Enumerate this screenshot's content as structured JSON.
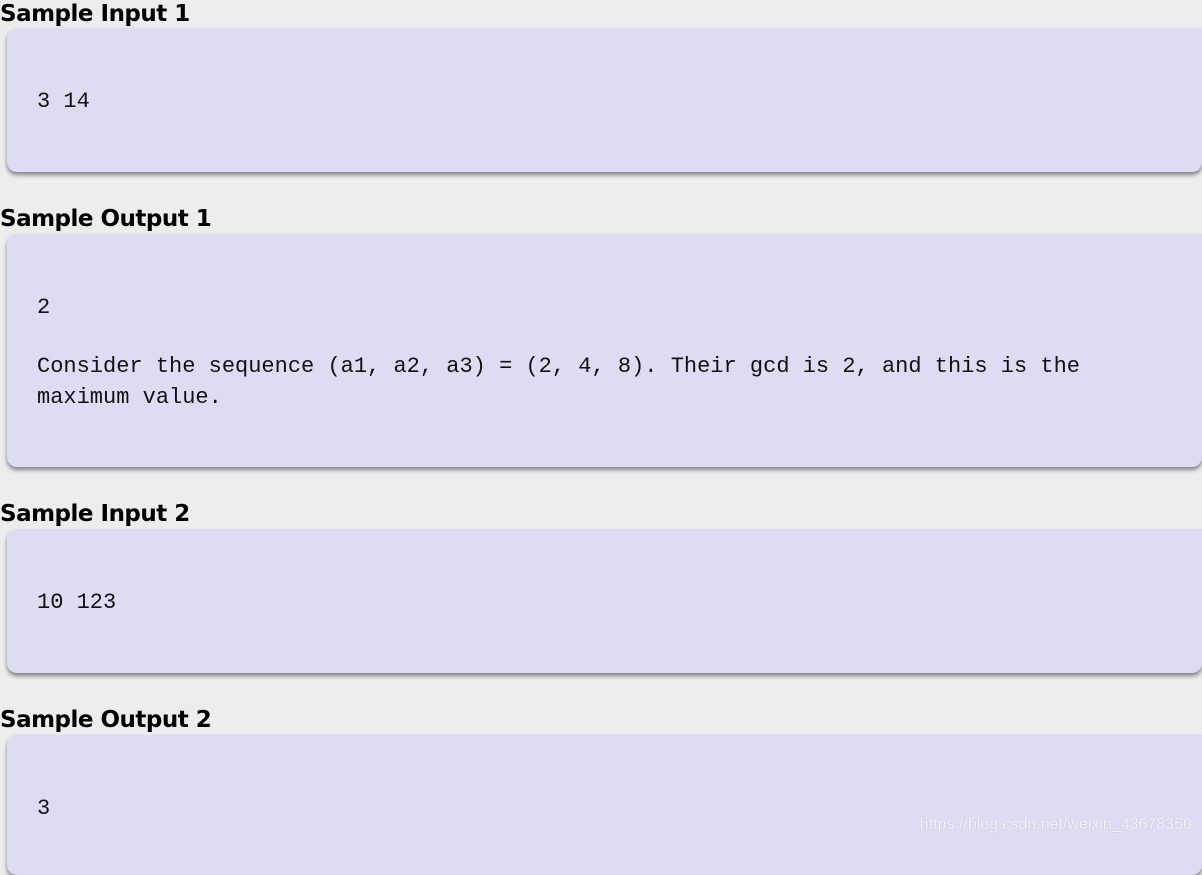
{
  "samples": [
    {
      "title": "Sample Input 1",
      "lines": [
        "3 14"
      ]
    },
    {
      "title": "Sample Output 1",
      "lines": [
        "2",
        "Consider the sequence (a1, a2, a3) = (2, 4, 8). Their gcd is 2, and this is the maximum value."
      ]
    },
    {
      "title": "Sample Input 2",
      "lines": [
        "10 123"
      ]
    },
    {
      "title": "Sample Output 2",
      "lines": [
        "3"
      ]
    }
  ],
  "watermark": "https://blog.csdn.net/weixin_43678350",
  "colors": {
    "box_background": "#dedcf3",
    "page_background": "#ededed"
  }
}
